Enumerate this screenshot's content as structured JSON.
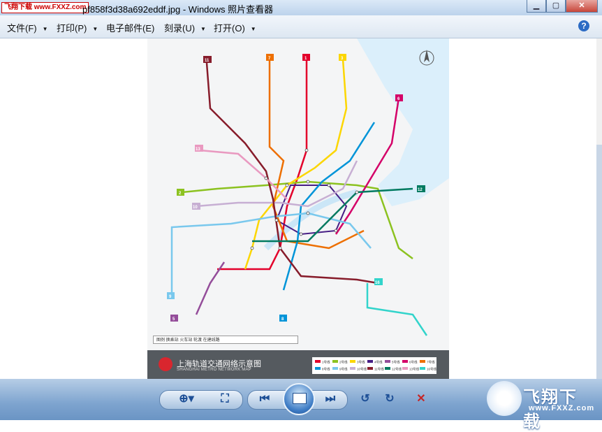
{
  "titlebar": {
    "watermark": "飞翔下载 www.FXXZ.com",
    "title": "pf858f3d38a692eddf.jpg - Windows 照片查看器",
    "minimize": "▁",
    "maximize": "▢",
    "close": "✕"
  },
  "menu": {
    "file": "文件(F)",
    "print": "打印(P)",
    "email": "电子邮件(E)",
    "burn": "刻录(U)",
    "open": "打开(O)",
    "help": "?"
  },
  "map": {
    "title_cn": "上海轨道交通网络示意图",
    "title_en": "SHANGHAI METRO NETWORK MAP",
    "legend_text": "图例  换乘站  火车站  轮渡  在建线路",
    "lines": [
      {
        "num": "1",
        "name": "1号线",
        "color": "#e3002b"
      },
      {
        "num": "2",
        "name": "2号线",
        "color": "#8cc220"
      },
      {
        "num": "3",
        "name": "3号线",
        "color": "#fcd600"
      },
      {
        "num": "4",
        "name": "4号线",
        "color": "#461d84"
      },
      {
        "num": "5",
        "name": "5号线",
        "color": "#944d9a"
      },
      {
        "num": "6",
        "name": "6号线",
        "color": "#d40068"
      },
      {
        "num": "7",
        "name": "7号线",
        "color": "#ed6f00"
      },
      {
        "num": "8",
        "name": "8号线",
        "color": "#0094d8"
      },
      {
        "num": "9",
        "name": "9号线",
        "color": "#79c8ed"
      },
      {
        "num": "10",
        "name": "10号线",
        "color": "#c7afd3"
      },
      {
        "num": "11",
        "name": "11号线",
        "color": "#871c2b"
      },
      {
        "num": "12",
        "name": "12号线",
        "color": "#007a60"
      },
      {
        "num": "13",
        "name": "13号线",
        "color": "#e999c0"
      },
      {
        "num": "16",
        "name": "16号线",
        "color": "#32d4cb"
      }
    ]
  },
  "brand": {
    "big": "飞翔下载",
    "url": "www.FXXZ.com"
  }
}
